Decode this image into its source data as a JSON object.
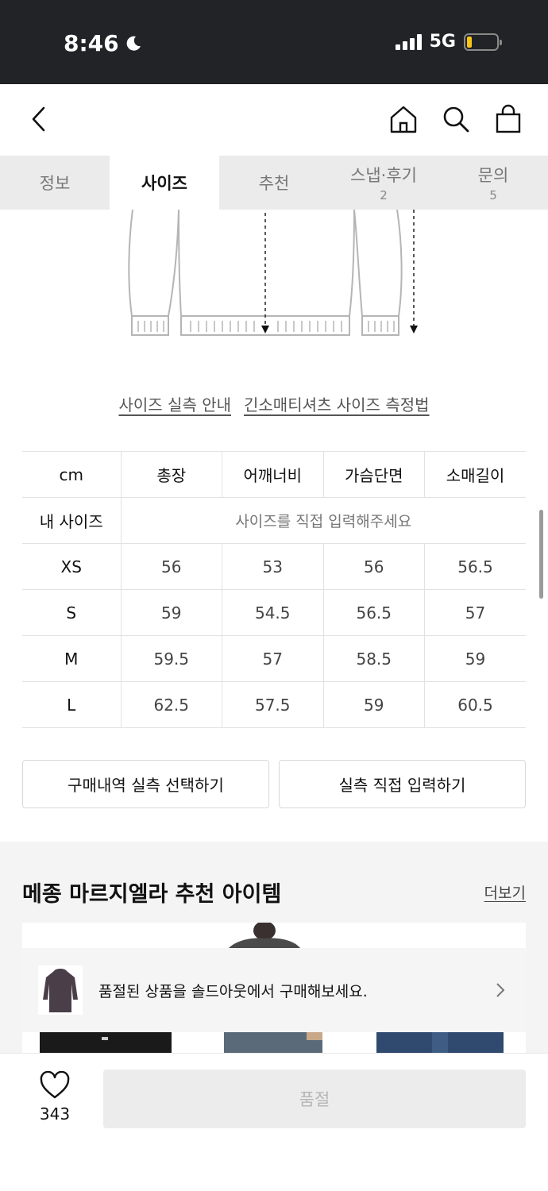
{
  "status_bar": {
    "time": "8:46",
    "network": "5G"
  },
  "tabs": [
    {
      "label": "정보",
      "count": ""
    },
    {
      "label": "사이즈",
      "count": ""
    },
    {
      "label": "추천",
      "count": ""
    },
    {
      "label": "스냅·후기",
      "count": "2"
    },
    {
      "label": "문의",
      "count": "5"
    }
  ],
  "guide_links": {
    "measure_guide": "사이즈 실측 안내",
    "method": "긴소매티셔츠 사이즈 측정법"
  },
  "size_table": {
    "unit": "cm",
    "headers": [
      "총장",
      "어깨너비",
      "가슴단면",
      "소매길이"
    ],
    "my_size_label": "내 사이즈",
    "my_size_hint": "사이즈를 직접 입력해주세요",
    "rows": [
      {
        "size": "XS",
        "values": [
          "56",
          "53",
          "56",
          "56.5"
        ]
      },
      {
        "size": "S",
        "values": [
          "59",
          "54.5",
          "56.5",
          "57"
        ]
      },
      {
        "size": "M",
        "values": [
          "59.5",
          "57",
          "58.5",
          "59"
        ]
      },
      {
        "size": "L",
        "values": [
          "62.5",
          "57.5",
          "59",
          "60.5"
        ]
      }
    ]
  },
  "actions": {
    "select_history": "구매내역 실측 선택하기",
    "direct_input": "실측 직접 입력하기"
  },
  "recommendations": {
    "title": "메종 마르지엘라 추천 아이템",
    "more": "더보기",
    "soldout_banner": "품절된 상품을 솔드아웃에서 구매해보세요."
  },
  "bottom_bar": {
    "like_count": "343",
    "soldout_button": "품절"
  },
  "colors": {
    "status_bar_bg": "#222326",
    "tab_bg": "#ebebeb",
    "battery": "#f5c518"
  }
}
